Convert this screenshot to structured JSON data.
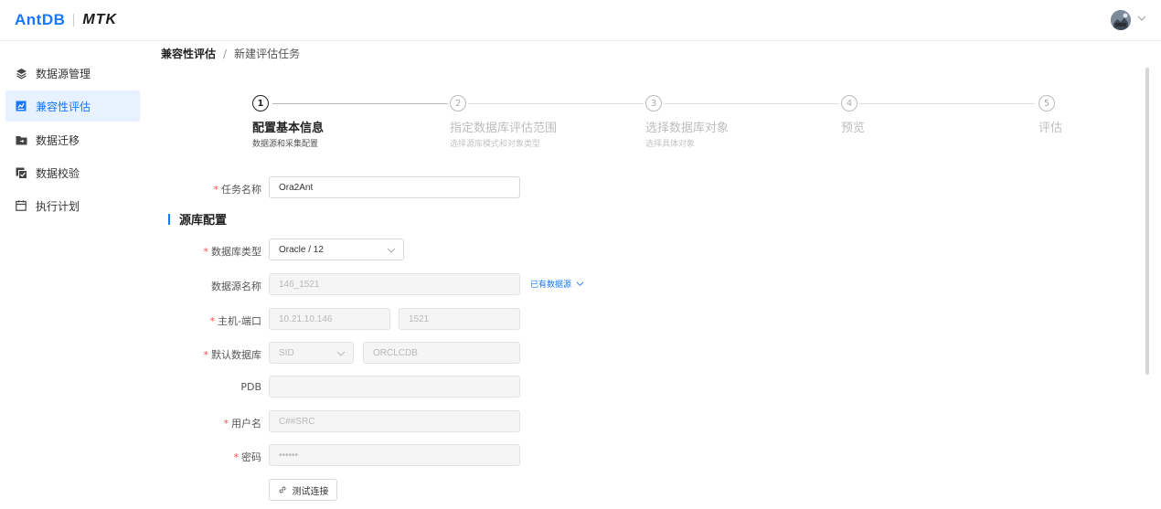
{
  "header": {
    "logo_antdb": "AntDB",
    "logo_mtk": "MTK",
    "avatar_icon": "user-avatar",
    "chevron_icon": "chevron-down-icon"
  },
  "sidebar": {
    "items": [
      {
        "label": "数据源管理",
        "icon": "layers-icon",
        "active": false
      },
      {
        "label": "兼容性评估",
        "icon": "assessment-icon",
        "active": true
      },
      {
        "label": "数据迁移",
        "icon": "folder-icon",
        "active": false
      },
      {
        "label": "数据校验",
        "icon": "copy-check-icon",
        "active": false
      },
      {
        "label": "执行计划",
        "icon": "calendar-icon",
        "active": false
      }
    ]
  },
  "breadcrumb": {
    "first": "兼容性评估",
    "separator": "/",
    "second": "新建评估任务"
  },
  "steps": [
    {
      "num": "1",
      "title": "配置基本信息",
      "desc": "数据源和采集配置",
      "active": true
    },
    {
      "num": "2",
      "title": "指定数据库评估范围",
      "desc": "选择源库模式和对象类型",
      "active": false
    },
    {
      "num": "3",
      "title": "选择数据库对象",
      "desc": "选择具体对象",
      "active": false
    },
    {
      "num": "4",
      "title": "预览",
      "desc": "",
      "active": false
    },
    {
      "num": "5",
      "title": "评估",
      "desc": "",
      "active": false
    }
  ],
  "form": {
    "task_name_label": "任务名称",
    "task_name_value": "Ora2Ant",
    "section_title": "源库配置",
    "db_type_label": "数据库类型",
    "db_type_value": "Oracle / 12",
    "ds_name_label": "数据源名称",
    "ds_name_value": "146_1521",
    "existing_ds_link": "已有数据源",
    "host_port_label": "主机-端口",
    "host_value": "10.21.10.146",
    "port_value": "1521",
    "default_db_label": "默认数据库",
    "default_db_type": "SID",
    "default_db_value": "ORCLCDB",
    "pdb_label": "PDB",
    "pdb_value": "",
    "user_label": "用户名",
    "user_value": "C##SRC",
    "password_label": "密码",
    "password_value": "••••••",
    "test_button": "测试连接"
  },
  "colors": {
    "accent": "#1677ff",
    "active_bg": "#e8f1ff",
    "required": "#ff4d4f"
  }
}
